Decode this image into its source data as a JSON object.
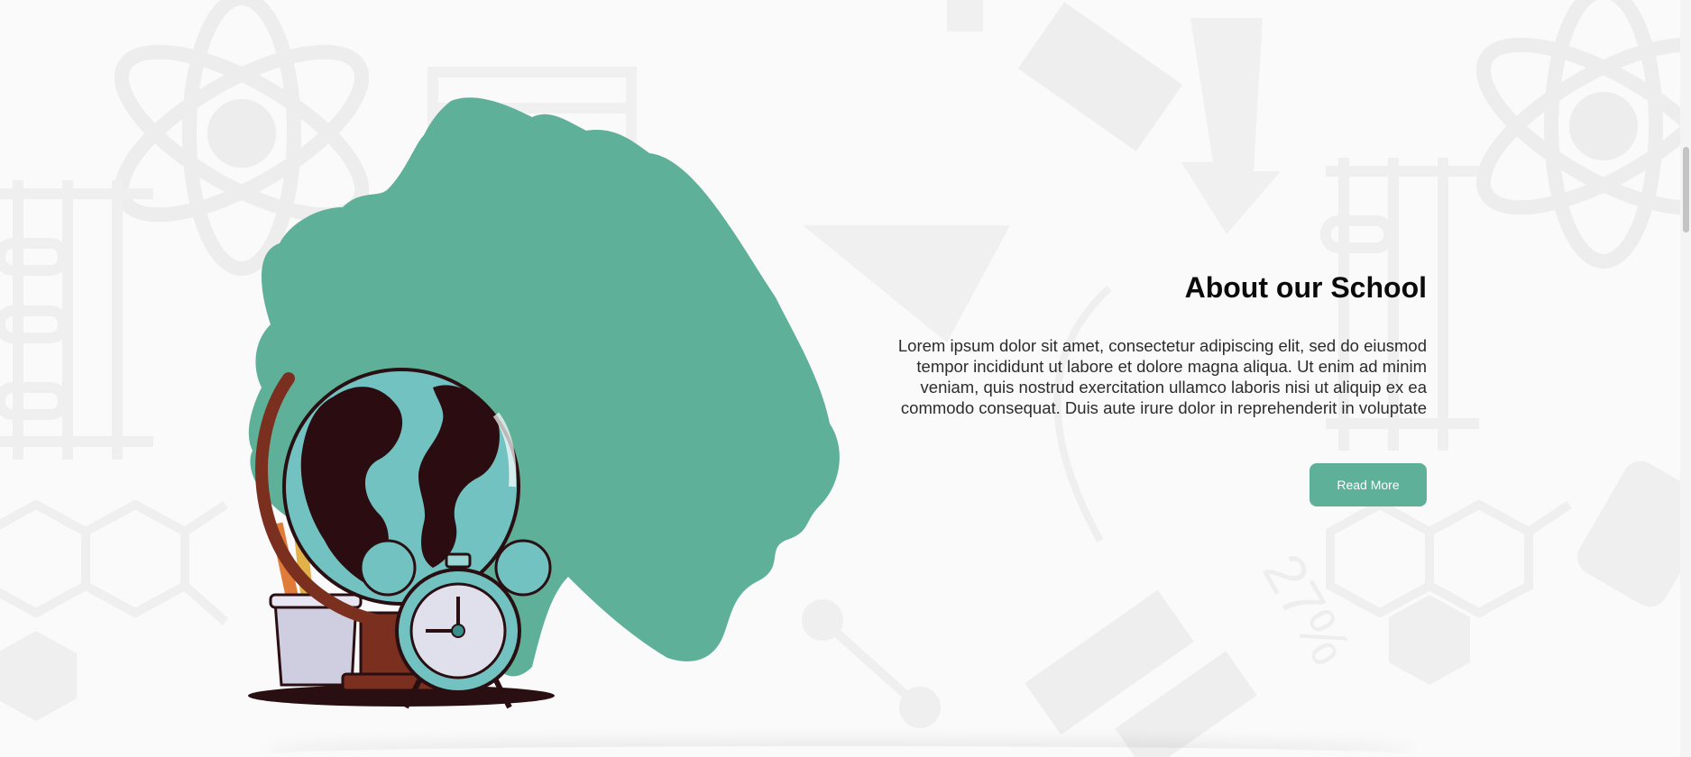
{
  "about": {
    "title": "About our School",
    "description": "Lorem ipsum dolor sit amet, consectetur adipiscing elit, sed do eiusmod tempor incididunt ut labore et dolore magna aliqua. Ut enim ad minim veniam, quis nostrud exercitation ullamco laboris nisi ut aliquip ex ea commodo consequat. Duis aute irure dolor in reprehenderit in voluptate",
    "button_label": "Read More"
  },
  "illustration": {
    "subject": "globe-and-alarm-clock"
  },
  "colors": {
    "accent": "#5fb098",
    "background": "#fafafa",
    "pattern": "#ececec"
  }
}
